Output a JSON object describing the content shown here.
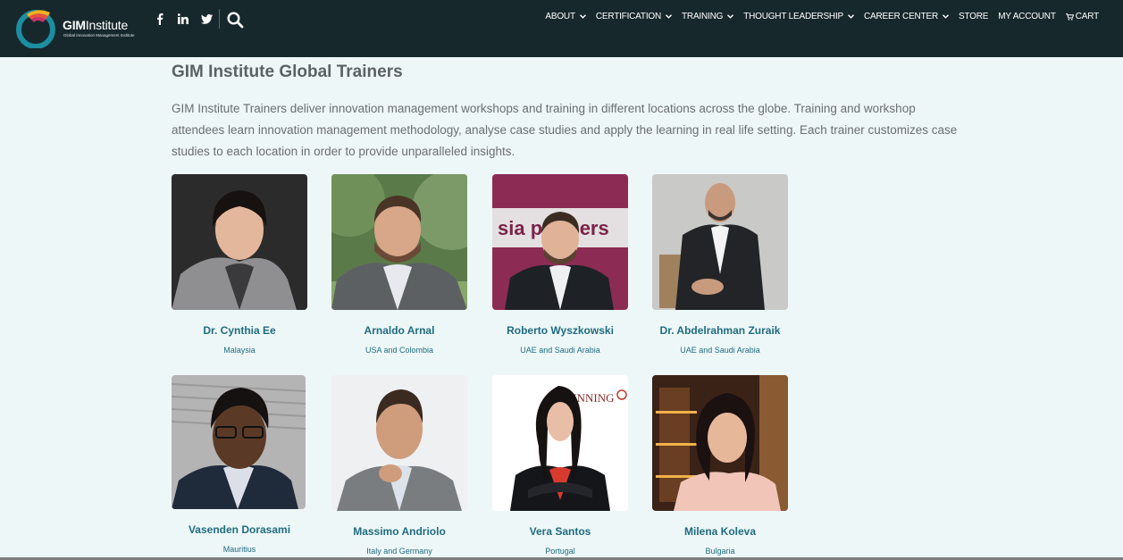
{
  "header": {
    "logo": {
      "brand_bold": "GIM",
      "brand_light": "Institute",
      "tagline": "Global Innovation Management Institute"
    },
    "social_icons": [
      "facebook-icon",
      "linkedin-icon",
      "twitter-icon"
    ],
    "nav": [
      {
        "label": "ABOUT",
        "dropdown": true
      },
      {
        "label": "CERTIFICATION",
        "dropdown": true
      },
      {
        "label": "TRAINING",
        "dropdown": true
      },
      {
        "label": "THOUGHT LEADERSHIP",
        "dropdown": true
      },
      {
        "label": "CAREER CENTER",
        "dropdown": true
      },
      {
        "label": "STORE",
        "dropdown": false
      },
      {
        "label": "MY ACCOUNT",
        "dropdown": false
      },
      {
        "label": "CART",
        "dropdown": false,
        "icon": "cart-icon"
      }
    ]
  },
  "main": {
    "title": "GIM Institute Global Trainers",
    "intro": "GIM Institute Trainers deliver innovation management workshops and training in different locations across the globe. Training and workshop attendees learn innovation management methodology, analyse case studies and apply the learning in real life setting. Each trainer customizes case studies to each location in order to provide unparalleled insights.",
    "trainers": [
      {
        "name": "Dr. Cynthia Ee",
        "location": "Malaysia"
      },
      {
        "name": "Arnaldo Arnal",
        "location": "USA and Colombia"
      },
      {
        "name": "Roberto Wyszkowski",
        "location": "UAE and Saudi Arabia",
        "photo_sign": "sia partners"
      },
      {
        "name": "Dr. Abdelrahman Zuraik",
        "location": "UAE and Saudi Arabia"
      },
      {
        "name": "Vasenden Dorasami",
        "location": "Mauritius"
      },
      {
        "name": "Massimo Andriolo",
        "location": "Italy and Germany"
      },
      {
        "name": "Vera Santos",
        "location": "Portugal",
        "photo_sign": "WINNING"
      },
      {
        "name": "Milena Koleva",
        "location": "Bulgaria"
      }
    ]
  },
  "colors": {
    "header_bg": "#17282d",
    "page_bg": "#eef7f7",
    "accent_text": "#1f6c80"
  }
}
